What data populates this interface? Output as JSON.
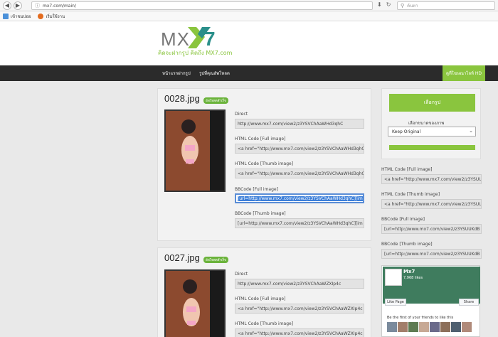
{
  "browser": {
    "url": "mx7.com/main/",
    "search_placeholder": "ค้นหา",
    "bookmarks": [
      "เข้าชมบ่อย",
      "เริ่มใช้งาน"
    ]
  },
  "site": {
    "logo_text": "MX",
    "logo_digits": "7",
    "tagline": "คิดจะฝากรูป คิดถึง MX7.com",
    "nav": [
      "หน้าแรกฝากรูป",
      "รูปที่คุณอัพโหลด"
    ],
    "nav_right": "ดูที่โฆษณาไลท์ HD",
    "accent": "#8ac53e"
  },
  "items": [
    {
      "filename": "0028.jpg",
      "badge": "อัพโหลดสำเร็จ",
      "fields": [
        {
          "label": "Direct",
          "value": "http://www.mx7.com/view2/z3YSVChAaWHd3qhC"
        },
        {
          "label": "HTML Code [Full image]",
          "value": "<a href=\"http://www.mx7.com/view2/z3YSVChAaWHd3qhC"
        },
        {
          "label": "HTML Code [Thumb image]",
          "value": "<a href=\"http://www.mx7.com/view2/z3YSVChAaWHd3qhC"
        },
        {
          "label": "BBCode [Full image]",
          "value": "[url=http://www.mx7.com/view2/z3YSVChAaWHd3qhC][im"
        },
        {
          "label": "BBCode [Thumb image]",
          "value": "[url=http://www.mx7.com/view2/z3YSVChAaWHd3qhC][im"
        }
      ]
    },
    {
      "filename": "0027.jpg",
      "badge": "อัพโหลดสำเร็จ",
      "fields": [
        {
          "label": "Direct",
          "value": "http://www.mx7.com/view2/z3YSVChAaWZXIp4c"
        },
        {
          "label": "HTML Code [Full image]",
          "value": "<a href=\"http://www.mx7.com/view2/z3YSVChAaWZXIp4c"
        },
        {
          "label": "HTML Code [Thumb image]",
          "value": "<a href=\"http://www.mx7.com/view2/z3YSVChAaWZXIp4c"
        }
      ]
    }
  ],
  "sidebar": {
    "upload_button": "เลือกรูป",
    "resize_label": "เลือกขนาดของภาพ",
    "resize_value": "Keep Original",
    "fields": [
      {
        "label": "HTML Code [Full image]",
        "value": "<a href=\"http://www.mx7.com/view2/z3YSUU"
      },
      {
        "label": "HTML Code [Thumb image]",
        "value": "<a href=\"http://www.mx7.com/view2/z3YSUU"
      },
      {
        "label": "BBCode [Full image]",
        "value": "[url=http://www.mx7.com/view2/z3YSUUKdB"
      },
      {
        "label": "BBCode [Thumb image]",
        "value": "[url=http://www.mx7.com/view2/z3YSUUKdB"
      }
    ],
    "facebook": {
      "name": "Mx7",
      "likes": "7,968 likes",
      "like_button": "Like Page",
      "share_button": "Share",
      "friends_text": "Be the first of your friends to like this"
    }
  }
}
